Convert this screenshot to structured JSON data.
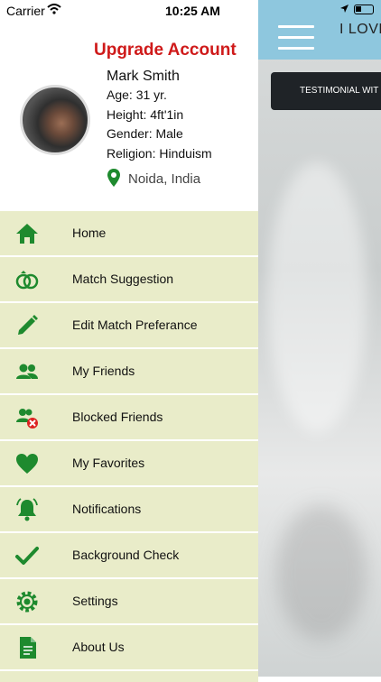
{
  "status_bar": {
    "carrier": "Carrier",
    "time": "10:25 AM"
  },
  "background_app": {
    "title": "I LOVE",
    "testimonial_button": "TESTIMONIAL WIT"
  },
  "drawer": {
    "upgrade_label": "Upgrade Account",
    "profile": {
      "name": "Mark Smith",
      "age": "Age: 31 yr.",
      "height": "Height: 4ft'1in",
      "gender": "Gender: Male",
      "religion": "Religion: Hinduism",
      "location": "Noida, India"
    },
    "menu": [
      {
        "label": "Home",
        "icon": "home-icon"
      },
      {
        "label": "Match Suggestion",
        "icon": "rings-icon"
      },
      {
        "label": "Edit Match Preferance",
        "icon": "pencil-icon"
      },
      {
        "label": "My Friends",
        "icon": "friends-icon"
      },
      {
        "label": "Blocked Friends",
        "icon": "blocked-user-icon"
      },
      {
        "label": "My Favorites",
        "icon": "heart-icon"
      },
      {
        "label": "Notifications",
        "icon": "bell-icon"
      },
      {
        "label": "Background Check",
        "icon": "checkmark-icon"
      },
      {
        "label": "Settings",
        "icon": "gear-icon"
      },
      {
        "label": "About Us",
        "icon": "document-icon"
      }
    ]
  },
  "colors": {
    "accent_green": "#1e8a2e",
    "menu_bg": "#e9ecc9",
    "upgrade_red": "#cf1a1a",
    "header_blue": "#8ec7de"
  }
}
